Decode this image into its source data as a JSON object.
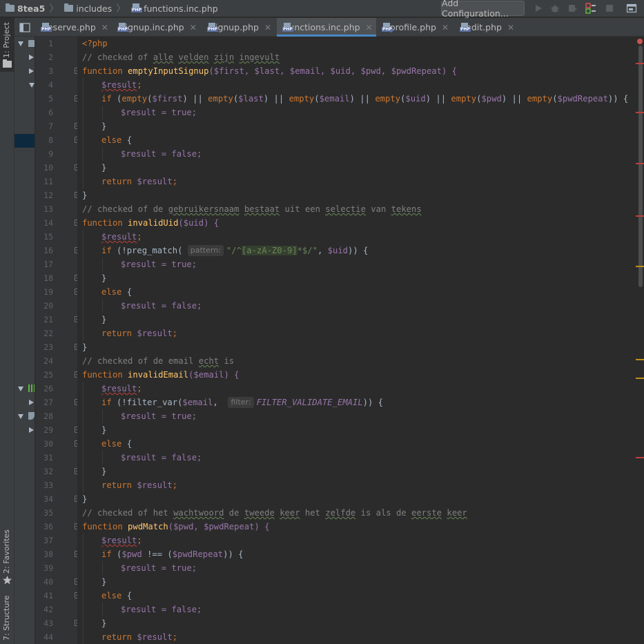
{
  "navbar": {
    "project": "8tea5",
    "folder": "includes",
    "file": "functions.inc.php",
    "add_config_label": "Add Configuration..."
  },
  "side_labels": {
    "project": "1: Project",
    "favorites": "2: Favorites",
    "structure": "7: Structure"
  },
  "tabs": [
    {
      "label": "reserve.php"
    },
    {
      "label": "signup.inc.php"
    },
    {
      "label": "signup.php"
    },
    {
      "label": "functions.inc.php"
    },
    {
      "label": "profile.php"
    },
    {
      "label": "edit.php"
    }
  ],
  "active_tab": "functions.inc.php",
  "tab_close": "✕",
  "code": {
    "line_numbers": [
      "1",
      "2",
      "3",
      "4",
      "5",
      "6",
      "7",
      "8",
      "9",
      "10",
      "11",
      "12",
      "13",
      "14",
      "15",
      "16",
      "17",
      "18",
      "19",
      "20",
      "21",
      "22",
      "23",
      "24",
      "25",
      "26",
      "27",
      "28",
      "29",
      "30",
      "31",
      "32",
      "33",
      "34",
      "35",
      "36",
      "37",
      "38",
      "39",
      "40",
      "41",
      "42",
      "43",
      "44"
    ],
    "php_open": "<?php",
    "comment1_pre": "// checked of ",
    "comment1_words": [
      "alle",
      "velden",
      "zijn",
      "ingevult"
    ],
    "function_kw": "function",
    "fn1_name": "emptyInputSignup",
    "fn1_params": "($first, $last, $email, $uid, $pwd, $pwdRepeat) {",
    "result_var": "$result",
    "semicolon": ";",
    "line5": {
      "if_kw": "if",
      "empty_kw": "empty",
      "args": [
        "$first",
        "$last",
        "$email",
        "$uid",
        "$pwd",
        "$pwdRepeat"
      ],
      "or_op": " || "
    },
    "assign_true": "$result = true;",
    "assign_false": "$result = false;",
    "close_brace": "}",
    "else_kw": "else",
    "return_kw": "return",
    "comment2_pre": "// checked of de ",
    "comment2_w1": "gebruikersnaam",
    "comment2_w2": "bestaat",
    "comment2_mid": " uit een ",
    "comment2_w3": "selectie",
    "comment2_mid2": " van ",
    "comment2_w4": "tekens",
    "fn2_name": "invalidUid",
    "fn2_params": "($uid) {",
    "preg_match": "preg_match",
    "pattern_hint": "pattern:",
    "regex_q1": "\"/^",
    "regex_class": "[a-zA-Z0-9]",
    "regex_q2": "*$/\"",
    "uid_var": "$uid",
    "comment3_pre": "// checked of de email ",
    "comment3_w1": "echt",
    "comment3_post": " is",
    "fn3_name": "invalidEmail",
    "fn3_params": "($email) {",
    "filter_var": "filter_var",
    "email_var": "$email",
    "filter_hint": "filter:",
    "filter_const": "FILTER_VALIDATE_EMAIL",
    "comment4_pre": "// checked of het ",
    "comment4_w1": "wachtwoord",
    "comment4_mid": " de ",
    "comment4_w2": "tweede",
    "comment4_sp": " ",
    "comment4_w3": "keer",
    "comment4_mid2": " het ",
    "comment4_w4": "zelfde",
    "comment4_mid3": " is als de ",
    "comment4_w5": "eerste",
    "comment4_w6": "keer",
    "fn4_name": "pwdMatch",
    "fn4_params": "($pwd, $pwdRepeat) {",
    "pwd_var": "$pwd",
    "neq_op": " !== ",
    "pwdrepeat_var": "$pwdRepeat"
  },
  "colors": {
    "keyword": "#cc7832",
    "variable": "#9876aa",
    "string": "#6a8759",
    "comment": "#808080",
    "function_name": "#ffc66d",
    "accent": "#4a88c7"
  }
}
